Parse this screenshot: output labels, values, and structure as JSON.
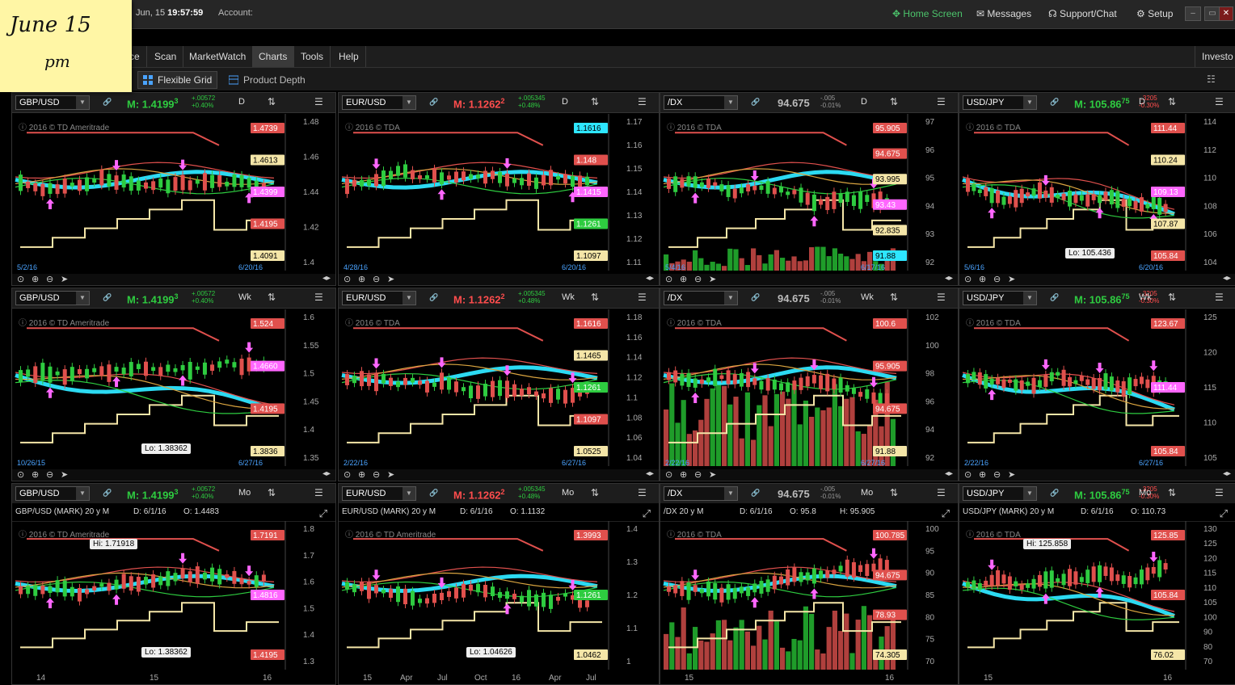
{
  "note": {
    "line1": "June 15",
    "line2": "pm"
  },
  "topbar": {
    "date": "Jun, 15",
    "time": "19:57:59",
    "account": "Account:",
    "home": "Home Screen",
    "messages": "Messages",
    "support": "Support/Chat",
    "setup": "Setup",
    "right_label": "Investo"
  },
  "menu": {
    "items": [
      "ce",
      "Scan",
      "MarketWatch",
      "Charts",
      "Tools",
      "Help"
    ],
    "active": "Charts"
  },
  "toolbar": {
    "flex": "Flexible Grid",
    "depth": "Product Depth"
  },
  "colors": {
    "bull": "#2ecc40",
    "bear": "#e0504d",
    "ma_slow": "#2ee6ff",
    "resistance": "#e0504d",
    "support_line": "#f5e6a8",
    "pink": "#ff66ff"
  },
  "panels": [
    {
      "symbol": "GBP/USD",
      "price": "M: 1.4199",
      "price_sub": "3",
      "pdir": "up",
      "chg1": "+.00572",
      "chg2": "+0.40%",
      "cdir": "up",
      "agg": "D",
      "copyright": "2016 © TD Ameritrade",
      "date_start": "5/2/16",
      "date_end": "6/20/16",
      "ticks": [
        "1.48",
        "1.46",
        "1.44",
        "1.42",
        "1.4"
      ],
      "tags": [
        {
          "v": "1.4739",
          "c": "#e0504d"
        },
        {
          "v": "1.4613",
          "c": "#f5e6a8"
        },
        {
          "v": "1.4399",
          "c": "#ff66ff"
        },
        {
          "v": "1.4195",
          "c": "#e0504d"
        },
        {
          "v": "1.4091",
          "c": "#f5e6a8"
        }
      ],
      "callout": "",
      "xlabels": []
    },
    {
      "symbol": "EUR/USD",
      "price": "M: 1.1262",
      "price_sub": "2",
      "pdir": "dn",
      "chg1": "+.005345",
      "chg2": "+0.48%",
      "cdir": "up",
      "agg": "D",
      "copyright": "2016 © TDA",
      "date_start": "4/28/16",
      "date_end": "6/20/16",
      "ticks": [
        "1.17",
        "1.16",
        "1.15",
        "1.14",
        "1.13",
        "1.12",
        "1.11"
      ],
      "tags": [
        {
          "v": "1.1616",
          "c": "#2ee6ff"
        },
        {
          "v": "1.148",
          "c": "#e0504d"
        },
        {
          "v": "1.1415",
          "c": "#ff66ff"
        },
        {
          "v": "1.1261",
          "c": "#2ecc40"
        },
        {
          "v": "1.1097",
          "c": "#f5e6a8"
        }
      ],
      "callout": "",
      "xlabels": []
    },
    {
      "symbol": "/DX",
      "price": "94.675",
      "price_sub": "",
      "pdir": "neu",
      "chg1": "-.005",
      "chg2": "-0.01%",
      "cdir": "neu",
      "agg": "D",
      "copyright": "2016 © TDA",
      "date_start": "5/4/16",
      "date_end": "6/17/16",
      "ticks": [
        "97",
        "96",
        "95",
        "94",
        "93",
        "92"
      ],
      "tags": [
        {
          "v": "95.905",
          "c": "#e0504d"
        },
        {
          "v": "94.675",
          "c": "#e0504d"
        },
        {
          "v": "93.995",
          "c": "#f5e6a8"
        },
        {
          "v": "93.43",
          "c": "#ff66ff"
        },
        {
          "v": "92.835",
          "c": "#f5e6a8"
        },
        {
          "v": "91.88",
          "c": "#2ee6ff"
        }
      ],
      "callout": "",
      "xlabels": []
    },
    {
      "symbol": "USD/JPY",
      "price": "M: 105.86",
      "price_sub": "75",
      "pdir": "up",
      "chg1": "-.3205",
      "chg2": "-0.30%",
      "cdir": "dn",
      "agg": "D",
      "copyright": "2016 © TDA",
      "date_start": "5/6/16",
      "date_end": "6/20/16",
      "ticks": [
        "114",
        "112",
        "110",
        "108",
        "106",
        "104"
      ],
      "tags": [
        {
          "v": "111.44",
          "c": "#e0504d"
        },
        {
          "v": "110.24",
          "c": "#f5e6a8"
        },
        {
          "v": "109.13",
          "c": "#ff66ff"
        },
        {
          "v": "107.87",
          "c": "#f5e6a8"
        },
        {
          "v": "105.84",
          "c": "#e0504d"
        }
      ],
      "callout": "Lo: 105.436",
      "xlabels": []
    },
    {
      "symbol": "GBP/USD",
      "price": "M: 1.4199",
      "price_sub": "3",
      "pdir": "up",
      "chg1": "+.00572",
      "chg2": "+0.40%",
      "cdir": "up",
      "agg": "Wk",
      "copyright": "2016 © TD Ameritrade",
      "date_start": "10/26/15",
      "date_end": "6/27/16",
      "ticks": [
        "1.6",
        "1.55",
        "1.5",
        "1.45",
        "1.4",
        "1.35"
      ],
      "tags": [
        {
          "v": "1.524",
          "c": "#e0504d"
        },
        {
          "v": "1.4660",
          "c": "#ff66ff"
        },
        {
          "v": "1.4195",
          "c": "#e0504d"
        },
        {
          "v": "1.3836",
          "c": "#f5e6a8"
        }
      ],
      "callout": "Lo: 1.38362",
      "xlabels": []
    },
    {
      "symbol": "EUR/USD",
      "price": "M: 1.1262",
      "price_sub": "2",
      "pdir": "dn",
      "chg1": "+.005345",
      "chg2": "+0.48%",
      "cdir": "up",
      "agg": "Wk",
      "copyright": "2016 © TDA",
      "date_start": "2/22/16",
      "date_end": "6/27/16",
      "ticks": [
        "1.18",
        "1.16",
        "1.14",
        "1.12",
        "1.1",
        "1.08",
        "1.06",
        "1.04"
      ],
      "tags": [
        {
          "v": "1.1616",
          "c": "#e0504d"
        },
        {
          "v": "1.1465",
          "c": "#f5e6a8"
        },
        {
          "v": "1.1261",
          "c": "#2ecc40"
        },
        {
          "v": "1.1097",
          "c": "#e0504d"
        },
        {
          "v": "1.0525",
          "c": "#f5e6a8"
        }
      ],
      "callout": "",
      "xlabels": []
    },
    {
      "symbol": "/DX",
      "price": "94.675",
      "price_sub": "",
      "pdir": "neu",
      "chg1": "-.005",
      "chg2": "-0.01%",
      "cdir": "neu",
      "agg": "Wk",
      "copyright": "2016 © TDA",
      "date_start": "2/22/16",
      "date_end": "6/27/16",
      "ticks": [
        "102",
        "100",
        "98",
        "96",
        "94",
        "92"
      ],
      "tags": [
        {
          "v": "100.6",
          "c": "#e0504d"
        },
        {
          "v": "95.905",
          "c": "#e0504d"
        },
        {
          "v": "94.675",
          "c": "#e0504d"
        },
        {
          "v": "91.88",
          "c": "#f5e6a8"
        }
      ],
      "callout": "",
      "xlabels": []
    },
    {
      "symbol": "USD/JPY",
      "price": "M: 105.86",
      "price_sub": "75",
      "pdir": "up",
      "chg1": "-.3205",
      "chg2": "-0.30%",
      "cdir": "dn",
      "agg": "Wk",
      "copyright": "2016 © TDA",
      "date_start": "2/22/16",
      "date_end": "6/27/16",
      "ticks": [
        "125",
        "120",
        "115",
        "110",
        "105"
      ],
      "tags": [
        {
          "v": "123.67",
          "c": "#e0504d"
        },
        {
          "v": "111.44",
          "c": "#ff66ff"
        },
        {
          "v": "105.84",
          "c": "#e0504d"
        }
      ],
      "callout": "",
      "xlabels": []
    },
    {
      "symbol": "GBP/USD",
      "price": "M: 1.4199",
      "price_sub": "3",
      "pdir": "up",
      "chg1": "+.00572",
      "chg2": "+0.40%",
      "cdir": "up",
      "agg": "Mo",
      "copyright": "2016 © TD Ameritrade",
      "header": "GBP/USD (MARK) 20 y M",
      "hd": "D: 6/1/16",
      "ho": "O: 1.4483",
      "hh": "",
      "ticks": [
        "1.8",
        "1.7",
        "1.6",
        "1.5",
        "1.4",
        "1.3"
      ],
      "tags": [
        {
          "v": "1.7191",
          "c": "#e0504d"
        },
        {
          "v": "1.4816",
          "c": "#ff66ff"
        },
        {
          "v": "1.4195",
          "c": "#e0504d"
        }
      ],
      "callout": "Lo: 1.38362",
      "callout_hi": "Hi: 1.71918",
      "xlabels": [
        "14",
        "15",
        "16"
      ]
    },
    {
      "symbol": "EUR/USD",
      "price": "M: 1.1262",
      "price_sub": "2",
      "pdir": "dn",
      "chg1": "+.005345",
      "chg2": "+0.48%",
      "cdir": "up",
      "agg": "Mo",
      "copyright": "2016 © TD Ameritrade",
      "header": "EUR/USD (MARK) 20 y M",
      "hd": "D: 6/1/16",
      "ho": "O: 1.1132",
      "hh": "",
      "ticks": [
        "1.4",
        "1.3",
        "1.2",
        "1.1",
        "1"
      ],
      "tags": [
        {
          "v": "1.3993",
          "c": "#e0504d"
        },
        {
          "v": "1.1261",
          "c": "#2ecc40"
        },
        {
          "v": "1.0462",
          "c": "#f5e6a8"
        }
      ],
      "callout": "Lo: 1.04626",
      "callout_hi": "",
      "xlabels": [
        "15",
        "Apr",
        "Jul",
        "Oct",
        "16",
        "Apr",
        "Jul"
      ]
    },
    {
      "symbol": "/DX",
      "price": "94.675",
      "price_sub": "",
      "pdir": "neu",
      "chg1": "-.005",
      "chg2": "-0.01%",
      "cdir": "neu",
      "agg": "Mo",
      "copyright": "2016 © TDA",
      "header": "/DX 20 y M",
      "hd": "D: 6/1/16",
      "ho": "O: 95.8",
      "hh": "H: 95.905",
      "ticks": [
        "100",
        "95",
        "90",
        "85",
        "80",
        "75",
        "70"
      ],
      "tags": [
        {
          "v": "100.785",
          "c": "#e0504d"
        },
        {
          "v": "94.675",
          "c": "#e0504d"
        },
        {
          "v": "78.93",
          "c": "#e0504d"
        },
        {
          "v": "74.305",
          "c": "#f5e6a8"
        }
      ],
      "callout": "",
      "callout_hi": "",
      "xlabels": [
        "15",
        "16"
      ]
    },
    {
      "symbol": "USD/JPY",
      "price": "M: 105.86",
      "price_sub": "75",
      "pdir": "up",
      "chg1": "-.3205",
      "chg2": "-0.30%",
      "cdir": "dn",
      "agg": "Mo",
      "copyright": "2016 © TDA",
      "header": "USD/JPY (MARK) 20 y M",
      "hd": "D: 6/1/16",
      "ho": "O: 110.73",
      "hh": "",
      "ticks": [
        "130",
        "125",
        "120",
        "115",
        "110",
        "105",
        "100",
        "90",
        "80",
        "70"
      ],
      "tags": [
        {
          "v": "125.85",
          "c": "#e0504d"
        },
        {
          "v": "105.84",
          "c": "#e0504d"
        },
        {
          "v": "76.02",
          "c": "#f5e6a8"
        }
      ],
      "callout": "",
      "callout_hi": "Hi: 125.858",
      "xlabels": [
        "15",
        "16"
      ]
    }
  ]
}
